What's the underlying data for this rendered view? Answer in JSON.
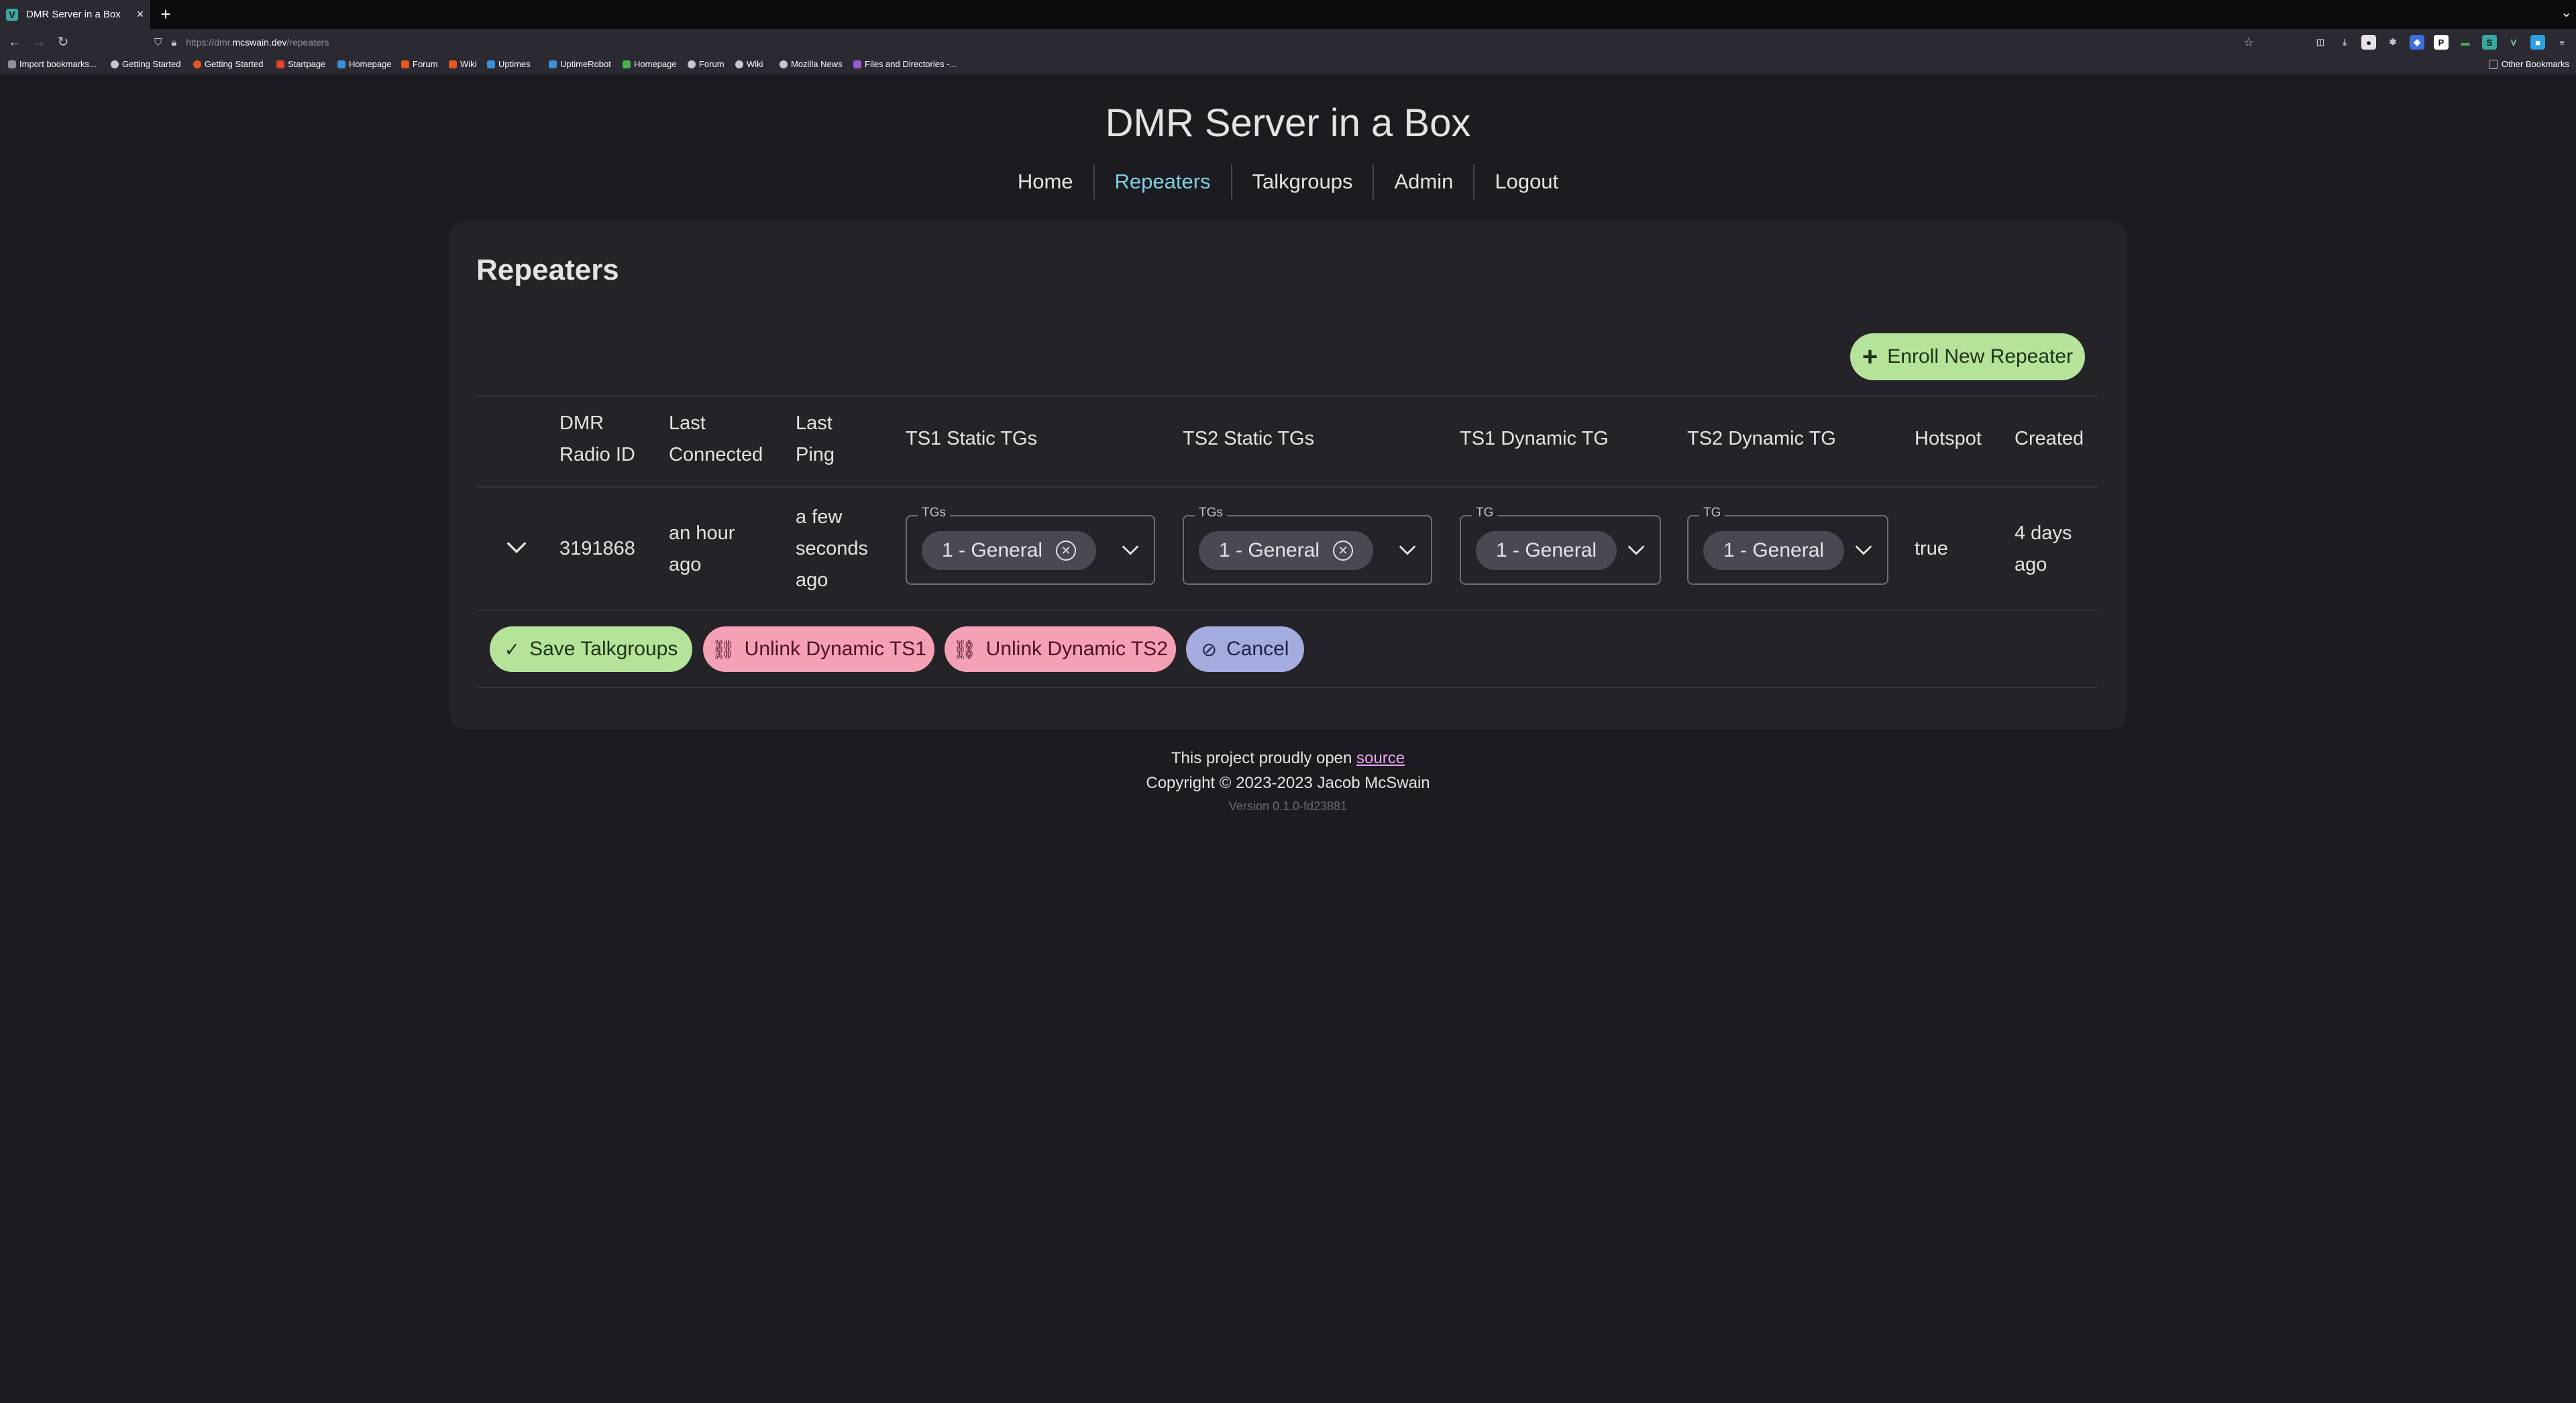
{
  "browser": {
    "tab_title": "DMR Server in a Box",
    "tab_favicon": "V",
    "url_prefix": "https://dmr.",
    "url_domain": "mcswain.dev",
    "url_path": "/repeaters",
    "bookmarks": [
      "Import bookmarks...",
      "Getting Started",
      "Getting Started",
      "Startpage",
      "Homepage",
      "Forum",
      "Wiki",
      "Uptimes",
      "UptimeRobot",
      "Homepage",
      "Forum",
      "Wiki",
      "Mozilla News",
      "Files and Directories -..."
    ],
    "other_bookmarks": "Other Bookmarks"
  },
  "site": {
    "title": "DMR Server in a Box"
  },
  "nav": {
    "items": [
      {
        "label": "Home",
        "active": false
      },
      {
        "label": "Repeaters",
        "active": true
      },
      {
        "label": "Talkgroups",
        "active": false
      },
      {
        "label": "Admin",
        "active": false
      },
      {
        "label": "Logout",
        "active": false
      }
    ]
  },
  "repeaters": {
    "heading": "Repeaters",
    "enroll_label": "Enroll New Repeater",
    "columns": [
      "DMR Radio ID",
      "Last Connected",
      "Last Ping",
      "TS1 Static TGs",
      "TS2 Static TGs",
      "TS1 Dynamic TG",
      "TS2 Dynamic TG",
      "Hotspot",
      "Created"
    ],
    "col_lines": {
      "dmr_radio_id": [
        "DMR",
        "Radio ID"
      ],
      "last_connected": [
        "Last",
        "Connected"
      ],
      "last_ping": [
        "Last",
        "Ping"
      ]
    },
    "row": {
      "dmr_radio_id": "3191868",
      "last_connected": [
        "an hour",
        "ago"
      ],
      "last_ping": [
        "a few",
        "seconds",
        "ago"
      ],
      "ts1_static": {
        "label": "TGs",
        "chip": "1 - General"
      },
      "ts2_static": {
        "label": "TGs",
        "chip": "1 - General"
      },
      "ts1_dynamic": {
        "label": "TG",
        "chip": "1 - General"
      },
      "ts2_dynamic": {
        "label": "TG",
        "chip": "1 - General"
      },
      "hotspot": "true",
      "created": [
        "4 days",
        "ago"
      ]
    },
    "actions": {
      "save": "Save Talkgroups",
      "unlink_ts1": "Unlink Dynamic TS1",
      "unlink_ts2": "Unlink Dynamic TS2",
      "cancel": "Cancel"
    }
  },
  "footer": {
    "line1_prefix": "This project proudly open",
    "line1_link": "source",
    "copyright": "Copyright © 2023-2023 Jacob McSwain",
    "version": "Version 0.1.0-fd23881"
  },
  "colors": {
    "background": "#1c1b1f",
    "card": "#242327",
    "accent_link": "#7fd0e2",
    "save_green": "#b6e39a",
    "unlink_pink": "#f4a0b5",
    "cancel_blue": "#a4acdf"
  }
}
